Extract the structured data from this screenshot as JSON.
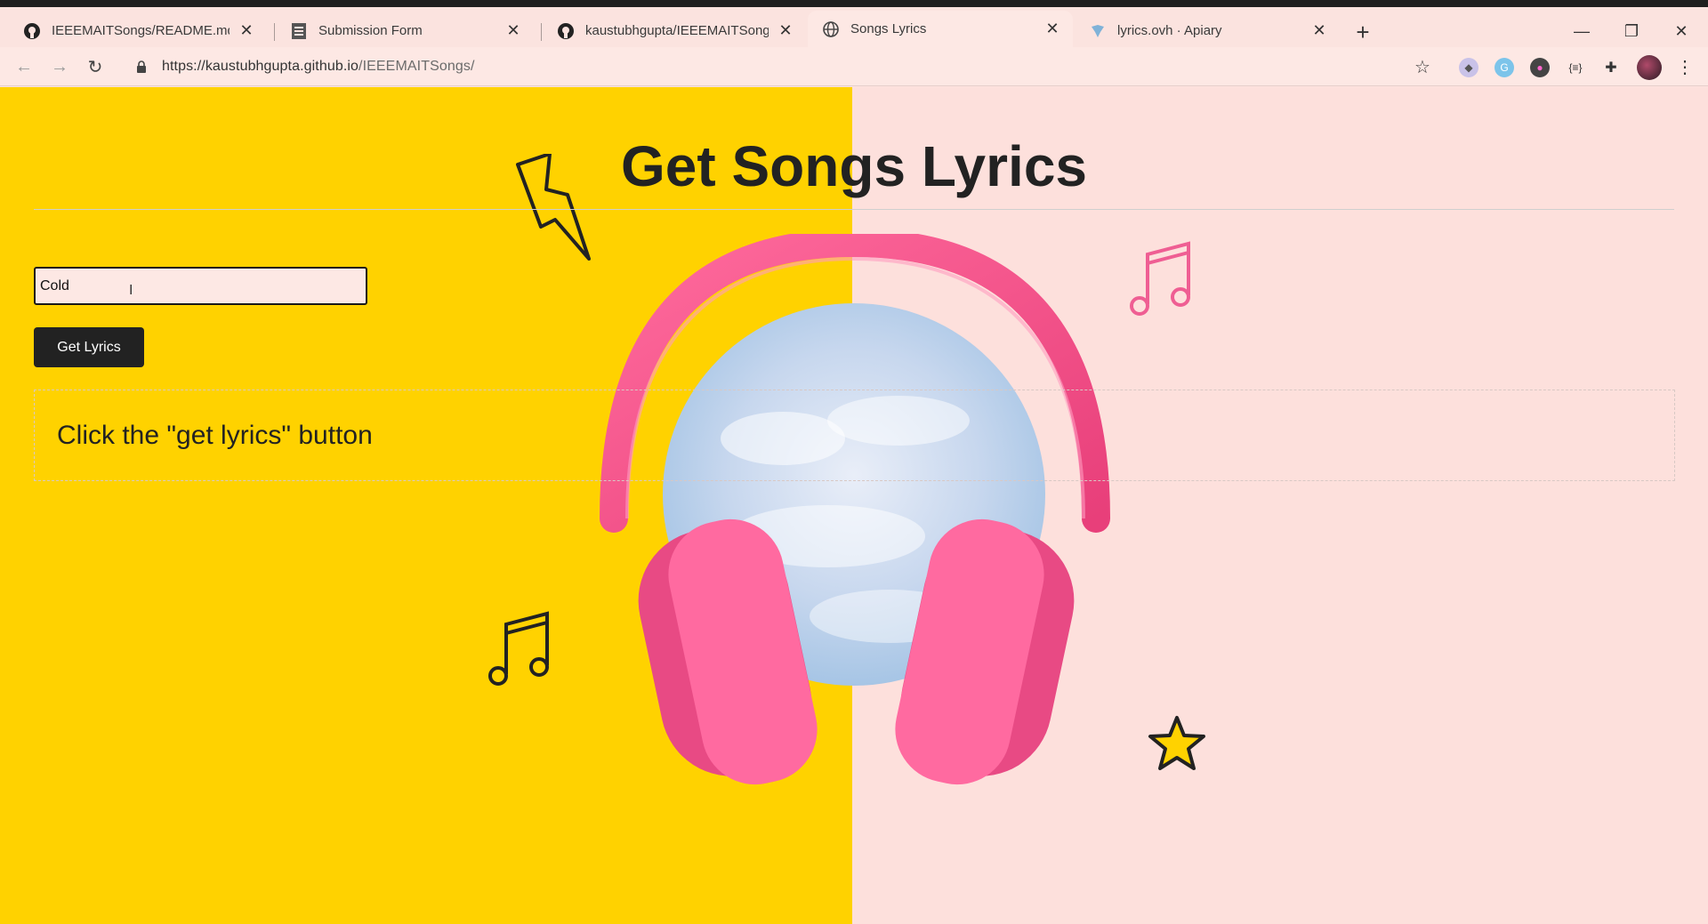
{
  "browser": {
    "tabs": [
      {
        "title": "IEEEMAITSongs/README.md at r",
        "icon": "github-icon"
      },
      {
        "title": "Submission Form",
        "icon": "form-icon"
      },
      {
        "title": "kaustubhgupta/IEEEMAITSongs",
        "icon": "github-icon"
      },
      {
        "title": "Songs Lyrics",
        "icon": "globe-icon",
        "active": true
      },
      {
        "title": "lyrics.ovh · Apiary",
        "icon": "apiary-icon"
      }
    ],
    "url_host": "https://kaustubhgupta.github.io",
    "url_path": "/IEEEMAITSongs/"
  },
  "page": {
    "title": "Get Songs Lyrics",
    "search_value": "Cold",
    "button_label": "Get Lyrics",
    "lyrics_message": "Click the \"get lyrics\" button"
  },
  "colors": {
    "left_panel": "#ffd200",
    "right_panel": "#fde0dc",
    "button": "#222222",
    "headphones": "#f0508a"
  }
}
